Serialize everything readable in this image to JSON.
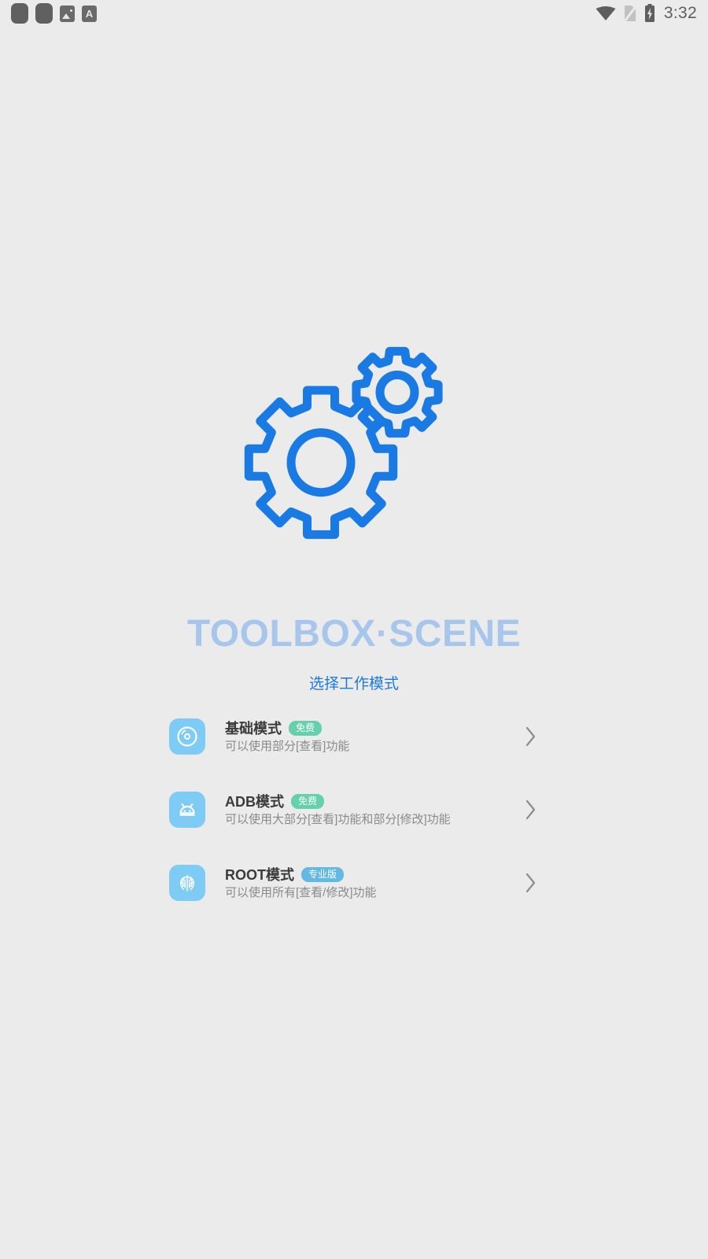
{
  "statusbar": {
    "left_icons": [
      {
        "name": "notification-blob-1",
        "glyph": ""
      },
      {
        "name": "notification-blob-2",
        "glyph": ""
      },
      {
        "name": "photo-icon",
        "glyph": ""
      },
      {
        "name": "translate-icon",
        "glyph": "A"
      }
    ],
    "right_icons": [
      {
        "name": "wifi-icon"
      },
      {
        "name": "no-sim-icon"
      },
      {
        "name": "battery-charging-icon"
      }
    ],
    "time": "3:32"
  },
  "hero": {
    "icon": "two-gears-icon",
    "color": "#1a7ae4"
  },
  "brand": {
    "title": "TOOLBOX·SCENE",
    "color": "#a7c6ec"
  },
  "subtitle": {
    "text": "选择工作模式",
    "color": "#1f7ae0"
  },
  "modes": [
    {
      "icon": "disc-icon",
      "title": "基础模式",
      "badge": "免费",
      "badge_kind": "free",
      "badge_color": "#64d0ac",
      "subtitle": "可以使用部分[查看]功能",
      "chevron": "chevron-right-icon"
    },
    {
      "icon": "android-icon",
      "title": "ADB模式",
      "badge": "免费",
      "badge_kind": "free",
      "badge_color": "#64d0ac",
      "subtitle": "可以使用大部分[查看]功能和部分[修改]功能",
      "chevron": "chevron-right-icon"
    },
    {
      "icon": "magisk-icon",
      "title": "ROOT模式",
      "badge": "专业版",
      "badge_kind": "pro",
      "badge_color": "#63b9e3",
      "subtitle": "可以使用所有[查看/修改]功能",
      "chevron": "chevron-right-icon"
    }
  ]
}
